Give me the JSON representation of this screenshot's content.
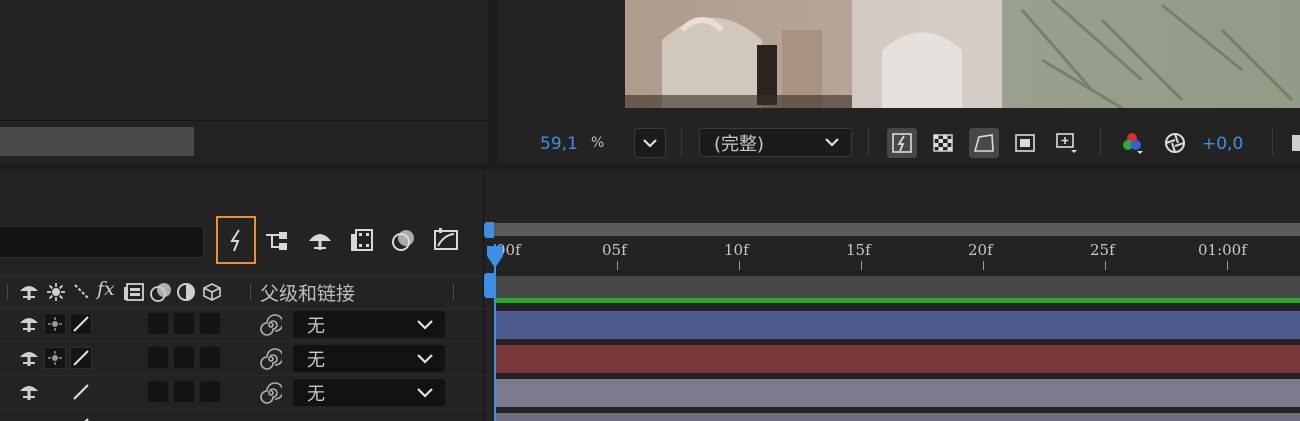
{
  "viewer": {
    "zoom_value": "59,1",
    "zoom_unit": "%",
    "resolution": "(完整)",
    "exposure": "+0,0"
  },
  "timeline": {
    "ruler_labels": [
      "00f",
      "05f",
      "10f",
      "15f",
      "20f",
      "25f",
      "01:00f"
    ],
    "parent_header": "父级和链接",
    "rows": [
      {
        "parent": "无",
        "bar_color": "#4d5a8e"
      },
      {
        "parent": "无",
        "bar_color": "#7a3838"
      },
      {
        "parent": "无",
        "bar_color": "#7c7a8c"
      }
    ]
  },
  "colors": {
    "accent_blue": "#3f8fe8",
    "highlight_orange": "#e8912d",
    "green_bar": "#2aa82a"
  },
  "icons": [
    "draft-3d-icon",
    "shy-layers-icon",
    "frame-blending-icon",
    "motion-blur-icon",
    "graph-editor-icon"
  ]
}
